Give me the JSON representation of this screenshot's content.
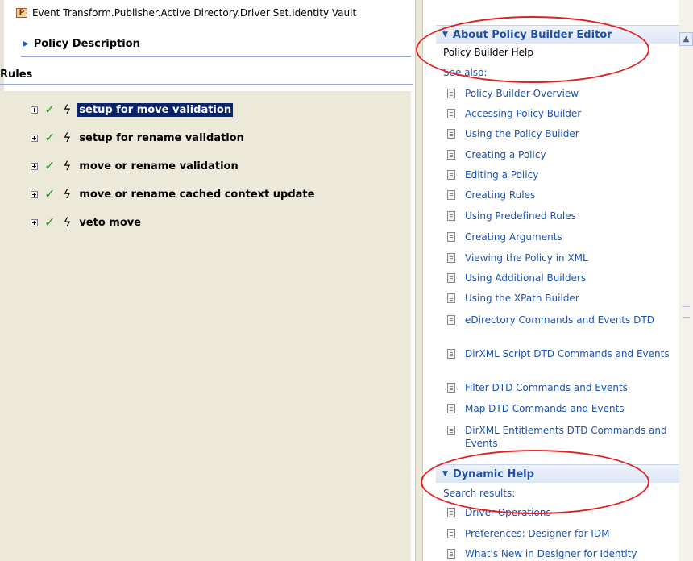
{
  "window": {
    "title": "Event Transform.Publisher.Active Directory.Driver Set.Identity Vault",
    "badge": "P"
  },
  "policy_description": {
    "label": "Policy Description"
  },
  "rules": {
    "title": "Rules",
    "items": [
      {
        "label": "setup for move validation",
        "selected": true
      },
      {
        "label": "setup for rename validation",
        "selected": false
      },
      {
        "label": "move or rename validation",
        "selected": false
      },
      {
        "label": "move or rename cached context update",
        "selected": false
      },
      {
        "label": "veto move",
        "selected": false
      }
    ]
  },
  "help": {
    "about": {
      "header": "About Policy Builder Editor",
      "help_label": "Policy Builder Help",
      "see_also": "See also:",
      "links": [
        "Policy Builder Overview",
        "Accessing Policy Builder",
        "Using the Policy Builder",
        "Creating a Policy",
        "Editing a Policy",
        "Creating Rules",
        "Using Predefined Rules",
        "Creating Arguments",
        "Viewing the Policy in XML",
        "Using Additional Builders",
        "Using the XPath Builder",
        "eDirectory Commands and Events DTD",
        "DirXML Script DTD Commands and Events",
        "Filter DTD Commands and Events",
        "Map DTD Commands and Events",
        "DirXML Entitlements DTD Commands and Events"
      ]
    },
    "dynamic": {
      "header": "Dynamic Help",
      "search_results": "Search results:",
      "links": [
        "Driver Operations",
        "Preferences: Designer for IDM",
        "What's New in Designer for Identity"
      ]
    }
  },
  "icons": {
    "expand": "expand-plus-icon",
    "check": "check-icon",
    "rule": "lightning-icon",
    "doc": "document-icon",
    "collapse": "triangle-down-icon",
    "scroll_up": "scroll-up-arrow-icon"
  },
  "colors": {
    "link": "#1c52b3",
    "selection": "#0a246a",
    "annotation": "#e02020",
    "check": "#2e9e2e"
  }
}
